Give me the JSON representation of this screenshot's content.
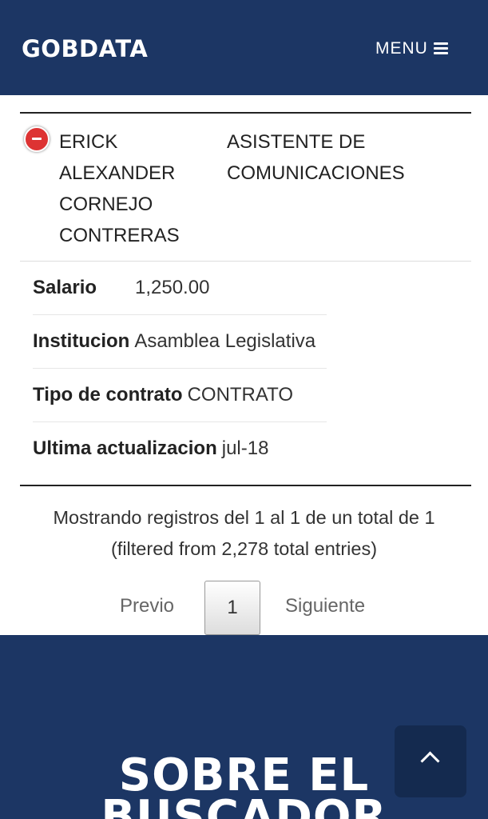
{
  "header": {
    "brand": "GOBDATA",
    "menu_label": "MENU"
  },
  "record": {
    "name": "ERICK ALEXANDER CORNEJO CONTRERAS",
    "role": "ASISTENTE DE COMUNICACIONES",
    "details": [
      {
        "label": "Salario",
        "value": "1,250.00"
      },
      {
        "label": "Institucion",
        "value": "Asamblea Legislativa"
      },
      {
        "label": "Tipo de contrato",
        "value": "CONTRATO"
      },
      {
        "label": "Ultima actualizacion",
        "value": "jul-18"
      }
    ]
  },
  "table_info": {
    "line1": "Mostrando registros del 1 al 1 de un total de 1",
    "line2": "(filtered from 2,278 total entries)"
  },
  "pagination": {
    "previous": "Previo",
    "current_page": "1",
    "next": "Siguiente"
  },
  "footer": {
    "title": "SOBRE EL BUSCADOR"
  },
  "icons": {
    "menu": "hamburger-icon",
    "row_toggle": "minus-circle-icon",
    "scroll_top": "chevron-up-icon"
  },
  "colors": {
    "navy": "#1c3664",
    "toggle_red": "#dd3333"
  }
}
